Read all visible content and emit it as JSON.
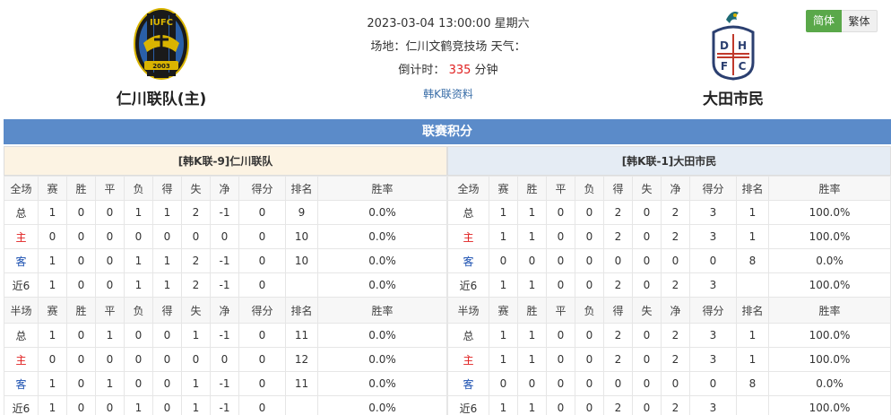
{
  "header": {
    "home_team": {
      "name": "仁川联队(主)",
      "logo_icon": "incheon-united-crest-icon",
      "logo_text": "IUFC",
      "logo_year": "2003"
    },
    "away_team": {
      "name": "大田市民",
      "logo_icon": "daejeon-hana-citizen-crest-icon",
      "logo_letters": [
        "D",
        "H",
        "F",
        "C"
      ]
    },
    "datetime": "2023-03-04 13:00:00 星期六",
    "venue_label": "场地：",
    "venue": "仁川文鹤竞技场",
    "weather_label": "天气：",
    "weather": "",
    "countdown_label": "倒计时：",
    "countdown_value": "335",
    "countdown_unit": "分钟",
    "league_link": "韩K联资料"
  },
  "lang_toggle": {
    "simplified": "简体",
    "traditional": "繁体"
  },
  "colors": {
    "accent_green": "#5aa84a",
    "league_bar_blue": "#5b8bc9",
    "home_red": "#e02020",
    "away_blue": "#1a4fb0"
  },
  "league_title": "联赛积分",
  "columns": [
    "赛",
    "胜",
    "平",
    "负",
    "得",
    "失",
    "净",
    "得分",
    "排名",
    "胜率"
  ],
  "home": {
    "title": "[韩K联-9]仁川联队",
    "full": {
      "label": "全场",
      "rows": [
        {
          "type": "总",
          "cells": [
            "1",
            "0",
            "0",
            "1",
            "1",
            "2",
            "-1",
            "0",
            "9",
            "0.0%"
          ]
        },
        {
          "type": "主",
          "cells": [
            "0",
            "0",
            "0",
            "0",
            "0",
            "0",
            "0",
            "0",
            "10",
            "0.0%"
          ]
        },
        {
          "type": "客",
          "cells": [
            "1",
            "0",
            "0",
            "1",
            "1",
            "2",
            "-1",
            "0",
            "10",
            "0.0%"
          ]
        },
        {
          "type": "近6",
          "cells": [
            "1",
            "0",
            "0",
            "1",
            "1",
            "2",
            "-1",
            "0",
            "",
            "0.0%"
          ]
        }
      ]
    },
    "half": {
      "label": "半场",
      "rows": [
        {
          "type": "总",
          "cells": [
            "1",
            "0",
            "1",
            "0",
            "0",
            "1",
            "-1",
            "0",
            "11",
            "0.0%"
          ]
        },
        {
          "type": "主",
          "cells": [
            "0",
            "0",
            "0",
            "0",
            "0",
            "0",
            "0",
            "0",
            "12",
            "0.0%"
          ]
        },
        {
          "type": "客",
          "cells": [
            "1",
            "0",
            "1",
            "0",
            "0",
            "1",
            "-1",
            "0",
            "11",
            "0.0%"
          ]
        },
        {
          "type": "近6",
          "cells": [
            "1",
            "0",
            "0",
            "1",
            "0",
            "1",
            "-1",
            "0",
            "",
            "0.0%"
          ]
        }
      ]
    }
  },
  "away": {
    "title": "[韩K联-1]大田市民",
    "full": {
      "label": "全场",
      "rows": [
        {
          "type": "总",
          "cells": [
            "1",
            "1",
            "0",
            "0",
            "2",
            "0",
            "2",
            "3",
            "1",
            "100.0%"
          ]
        },
        {
          "type": "主",
          "cells": [
            "1",
            "1",
            "0",
            "0",
            "2",
            "0",
            "2",
            "3",
            "1",
            "100.0%"
          ]
        },
        {
          "type": "客",
          "cells": [
            "0",
            "0",
            "0",
            "0",
            "0",
            "0",
            "0",
            "0",
            "8",
            "0.0%"
          ]
        },
        {
          "type": "近6",
          "cells": [
            "1",
            "1",
            "0",
            "0",
            "2",
            "0",
            "2",
            "3",
            "",
            "100.0%"
          ]
        }
      ]
    },
    "half": {
      "label": "半场",
      "rows": [
        {
          "type": "总",
          "cells": [
            "1",
            "1",
            "0",
            "0",
            "2",
            "0",
            "2",
            "3",
            "1",
            "100.0%"
          ]
        },
        {
          "type": "主",
          "cells": [
            "1",
            "1",
            "0",
            "0",
            "2",
            "0",
            "2",
            "3",
            "1",
            "100.0%"
          ]
        },
        {
          "type": "客",
          "cells": [
            "0",
            "0",
            "0",
            "0",
            "0",
            "0",
            "0",
            "0",
            "8",
            "0.0%"
          ]
        },
        {
          "type": "近6",
          "cells": [
            "1",
            "1",
            "0",
            "0",
            "2",
            "0",
            "2",
            "3",
            "",
            "100.0%"
          ]
        }
      ]
    }
  }
}
